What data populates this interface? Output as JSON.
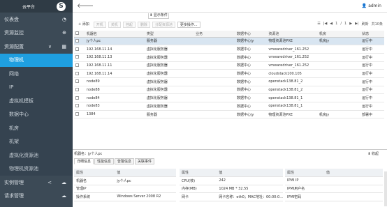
{
  "brand": {
    "title": "云平台",
    "logo": "S"
  },
  "nav": {
    "items_top": [
      {
        "label": "仪表盘",
        "icon": "dashboard-icon",
        "glyph": "◔"
      },
      {
        "label": "资源监控",
        "icon": "binoculars-icon",
        "glyph": "⊕"
      },
      {
        "label": "资源配置",
        "icon": "grid-icon",
        "glyph": "▦",
        "chevron": "∨"
      }
    ],
    "sub": [
      "物理机",
      "网络",
      "IP",
      "虚拟机模板",
      "数据中心",
      "机房",
      "机架",
      "虚拟化资源池",
      "物理机资源池"
    ],
    "items_bottom": [
      {
        "label": "实例管理",
        "chevron": "<",
        "icon": "cloud-icon",
        "glyph": "☁"
      },
      {
        "label": "请求管理",
        "icon": "cloud-icon",
        "glyph": "☁"
      }
    ]
  },
  "topbar": {
    "back": "🡐",
    "user": "admin",
    "collapse": "显示条件"
  },
  "toolbar": {
    "add": "+ 添加",
    "buttons": [
      "开机",
      "关机",
      "挂起",
      "删除",
      "分配资源池"
    ],
    "more": "更多操作..."
  },
  "pager": {
    "items": [
      "☰",
      "|◀",
      "◀",
      "1",
      "/",
      "1",
      "▶",
      "▶|",
      "刷新",
      "共10条"
    ]
  },
  "grid": {
    "columns": [
      "机器名",
      "类型",
      "业务",
      "数据中心",
      "资源池",
      "机房",
      "状态"
    ],
    "rows": [
      {
        "name": "jy个人pc",
        "type": "服务器",
        "biz": "",
        "dc": "数据中心jy",
        "pool": "物理资源池PXE",
        "room": "机房jy",
        "status": "运行中",
        "sel": true
      },
      {
        "name": "192.168.11.14",
        "type": "虚拟化服务器",
        "biz": "",
        "dc": "数据中心",
        "pool": "vmwaredriver_161.252",
        "room": "",
        "status": "运行中"
      },
      {
        "name": "192.168.11.13",
        "type": "虚拟化服务器",
        "biz": "",
        "dc": "数据中心",
        "pool": "vmwaredriver_161.252",
        "room": "",
        "status": "运行中"
      },
      {
        "name": "192.168.11.11",
        "type": "虚拟化服务器",
        "biz": "",
        "dc": "数据中心",
        "pool": "vmwaredriver_161.252",
        "room": "",
        "status": "运行中"
      },
      {
        "name": "192.168.11.14",
        "type": "虚拟化服务器",
        "biz": "",
        "dc": "数据中心",
        "pool": "cloudstack100.105",
        "room": "",
        "status": "运行中"
      },
      {
        "name": "node89",
        "type": "虚拟化服务器",
        "biz": "",
        "dc": "数据中心",
        "pool": "openstack138.81_2",
        "room": "",
        "status": "运行中"
      },
      {
        "name": "node88",
        "type": "虚拟化服务器",
        "biz": "",
        "dc": "数据中心",
        "pool": "openstack138.81_2",
        "room": "",
        "status": "运行中"
      },
      {
        "name": "node84",
        "type": "虚拟化服务器",
        "biz": "",
        "dc": "数据中心",
        "pool": "openstack138.81_1",
        "room": "",
        "status": "运行中"
      },
      {
        "name": "node83",
        "type": "虚拟化服务器",
        "biz": "",
        "dc": "数据中心",
        "pool": "openstack138.81_1",
        "room": "",
        "status": "运行中"
      },
      {
        "name": "1384",
        "type": "服务器",
        "biz": "",
        "dc": "数据中心jy",
        "pool": "物理资源池PXE",
        "room": "机房jy",
        "status": "部署中"
      }
    ]
  },
  "detail": {
    "title": "机器名：jy个人pc",
    "fold": "⬇ 收起",
    "tabs": [
      "详细信息",
      "性能信息",
      "告警信息",
      "关联事件"
    ],
    "header": [
      "属性",
      "值"
    ],
    "t1": [
      [
        "机器名",
        "jy个人pc"
      ],
      [
        "管理IP",
        ""
      ],
      [
        "操作系统",
        "Windows Server 2008 R2"
      ]
    ],
    "t2": [
      [
        "CPU(核)",
        "242"
      ],
      [
        "内存(MB)",
        "1024 MB * 32.55"
      ],
      [
        "网卡",
        "网卡名称：eth0；MAC地址：00:00:0..."
      ]
    ],
    "t3": [
      [
        "IPMI IP",
        ""
      ],
      [
        "IPMI用户名",
        ""
      ],
      [
        "IPMI密码",
        ""
      ]
    ]
  }
}
